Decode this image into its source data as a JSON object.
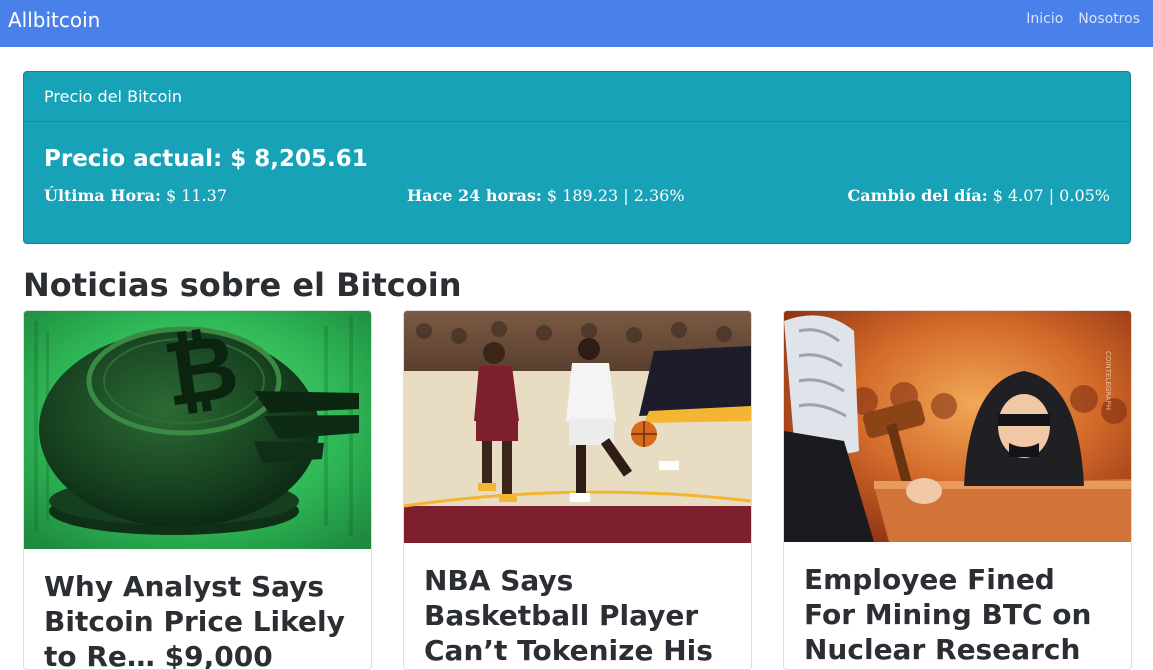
{
  "navbar": {
    "brand": "Allbitcoin",
    "links": [
      "Inicio",
      "Nosotros"
    ]
  },
  "price_card": {
    "header": "Precio del Bitcoin",
    "current_label": "Precio actual:",
    "current_value": "$ 8,205.61",
    "last_hour_label": "Última Hora:",
    "last_hour_value": "$ 11.37",
    "last_24h_label": "Hace 24 horas:",
    "last_24h_value": "$ 189.23 | 2.36%",
    "day_change_label": "Cambio del día:",
    "day_change_value": "$ 4.07 | 0.05%"
  },
  "news": {
    "heading": "Noticias sobre el Bitcoin",
    "articles": [
      {
        "title": "Why Analyst Says Bitcoin Price Likely to Re… $9,000",
        "image": "broken-bitcoin-coin-green"
      },
      {
        "title": "NBA Says Basketball Player Can’t Tokenize His Contract After All",
        "image": "basketball-game-players"
      },
      {
        "title": "Employee Fined For Mining BTC on Nuclear Research",
        "image": "judge-gavel-hooded-man"
      }
    ]
  },
  "colors": {
    "navbar_bg": "#4a80ea",
    "card_bg": "#17a2b8",
    "heading_text": "#2b2f33"
  }
}
